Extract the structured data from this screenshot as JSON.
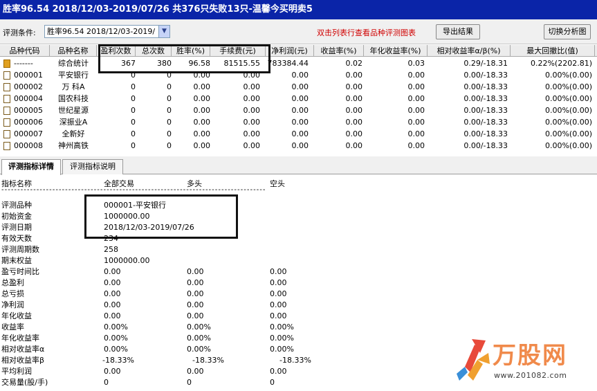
{
  "window": {
    "title": "胜率96.54   2018/12/03-2019/07/26 共376只失败13只-温馨今买明卖5"
  },
  "toolbar": {
    "condition_label": "评测条件:",
    "condition_value": "胜率96.54   2018/12/03-2019/",
    "hint": "双击列表行查看品种评测图表",
    "export_label": "导出结果",
    "switch_label": "切换分析图"
  },
  "grid": {
    "columns": [
      "品种代码",
      "品种名称",
      "盈利次数",
      "总次数",
      "胜率(%)",
      "手续费(元)",
      "净利润(元)",
      "收益率(%)",
      "年化收益率(%)",
      "相对收益率α/β(%)",
      "最大回撤比(值)"
    ],
    "rows": [
      {
        "code": "-------",
        "name": "综合统计",
        "win": "367",
        "total": "380",
        "rate": "96.58",
        "fee": "81515.55",
        "profit": "783384.44",
        "ret": "0.02",
        "annual": "0.03",
        "rel": "0.29/-18.31",
        "dd": "0.22%(2202.81)"
      },
      {
        "code": "000001",
        "name": "平安银行",
        "win": "0",
        "total": "0",
        "rate": "0.00",
        "fee": "0.00",
        "profit": "0.00",
        "ret": "0.00",
        "annual": "0.00",
        "rel": "0.00/-18.33",
        "dd": "0.00%(0.00)"
      },
      {
        "code": "000002",
        "name": "万 科A",
        "win": "0",
        "total": "0",
        "rate": "0.00",
        "fee": "0.00",
        "profit": "0.00",
        "ret": "0.00",
        "annual": "0.00",
        "rel": "0.00/-18.33",
        "dd": "0.00%(0.00)"
      },
      {
        "code": "000004",
        "name": "国农科技",
        "win": "0",
        "total": "0",
        "rate": "0.00",
        "fee": "0.00",
        "profit": "0.00",
        "ret": "0.00",
        "annual": "0.00",
        "rel": "0.00/-18.33",
        "dd": "0.00%(0.00)"
      },
      {
        "code": "000005",
        "name": "世纪星源",
        "win": "0",
        "total": "0",
        "rate": "0.00",
        "fee": "0.00",
        "profit": "0.00",
        "ret": "0.00",
        "annual": "0.00",
        "rel": "0.00/-18.33",
        "dd": "0.00%(0.00)"
      },
      {
        "code": "000006",
        "name": "深振业A",
        "win": "0",
        "total": "0",
        "rate": "0.00",
        "fee": "0.00",
        "profit": "0.00",
        "ret": "0.00",
        "annual": "0.00",
        "rel": "0.00/-18.33",
        "dd": "0.00%(0.00)"
      },
      {
        "code": "000007",
        "name": "全新好",
        "win": "0",
        "total": "0",
        "rate": "0.00",
        "fee": "0.00",
        "profit": "0.00",
        "ret": "0.00",
        "annual": "0.00",
        "rel": "0.00/-18.33",
        "dd": "0.00%(0.00)"
      },
      {
        "code": "000008",
        "name": "神州高铁",
        "win": "0",
        "total": "0",
        "rate": "0.00",
        "fee": "0.00",
        "profit": "0.00",
        "ret": "0.00",
        "annual": "0.00",
        "rel": "0.00/-18.33",
        "dd": "0.00%(0.00)"
      }
    ]
  },
  "tabs": [
    {
      "label": "评测指标详情"
    },
    {
      "label": "评测指标说明"
    }
  ],
  "detail": {
    "headers": {
      "name": "指标名称",
      "all": "全部交易",
      "long": "多头",
      "short": "空头"
    },
    "dashes": "-----------------------------------------------------------------------------------",
    "rows": [
      {
        "name": "评测品种",
        "all": "000001-平安银行",
        "long": "",
        "short": ""
      },
      {
        "name": "初始资金",
        "all": "1000000.00",
        "long": "",
        "short": ""
      },
      {
        "name": "评测日期",
        "all": "2018/12/03-2019/07/26",
        "long": "",
        "short": ""
      },
      {
        "name": "有效天数",
        "all": "234",
        "long": "",
        "short": ""
      },
      {
        "name": "评测周期数",
        "all": "258",
        "long": "",
        "short": ""
      },
      {
        "name": "期末权益",
        "all": "1000000.00",
        "long": "",
        "short": ""
      },
      {
        "name": "盈亏时间比",
        "all": "0.00",
        "long": "0.00",
        "short": "0.00"
      },
      {
        "name": "总盈利",
        "all": "0.00",
        "long": "0.00",
        "short": "0.00"
      },
      {
        "name": "总亏损",
        "all": "0.00",
        "long": "0.00",
        "short": "0.00"
      },
      {
        "name": "净利润",
        "all": "0.00",
        "long": "0.00",
        "short": "0.00"
      },
      {
        "name": "年化收益",
        "all": "0.00",
        "long": "0.00",
        "short": "0.00"
      },
      {
        "name": "收益率",
        "all": "0.00%",
        "long": "0.00%",
        "short": "0.00%"
      },
      {
        "name": "年化收益率",
        "all": "0.00%",
        "long": "0.00%",
        "short": "0.00%"
      },
      {
        "name": "相对收益率α",
        "all": "0.00%",
        "long": "0.00%",
        "short": "0.00%"
      },
      {
        "name": "相对收益率β",
        "all": "-18.33%",
        "long": "-18.33%",
        "short": "-18.33%"
      },
      {
        "name": "平均利润",
        "all": "0.00",
        "long": "0.00",
        "short": "0.00"
      },
      {
        "name": "交易量(股/手)",
        "all": "0",
        "long": "0",
        "short": "0"
      }
    ]
  },
  "watermark": {
    "brand": "万股网",
    "url": "www.201082.com"
  },
  "colors": {
    "titlebar": "#0a24a8",
    "hint": "#d00000",
    "watermark": "#f08a4b"
  }
}
